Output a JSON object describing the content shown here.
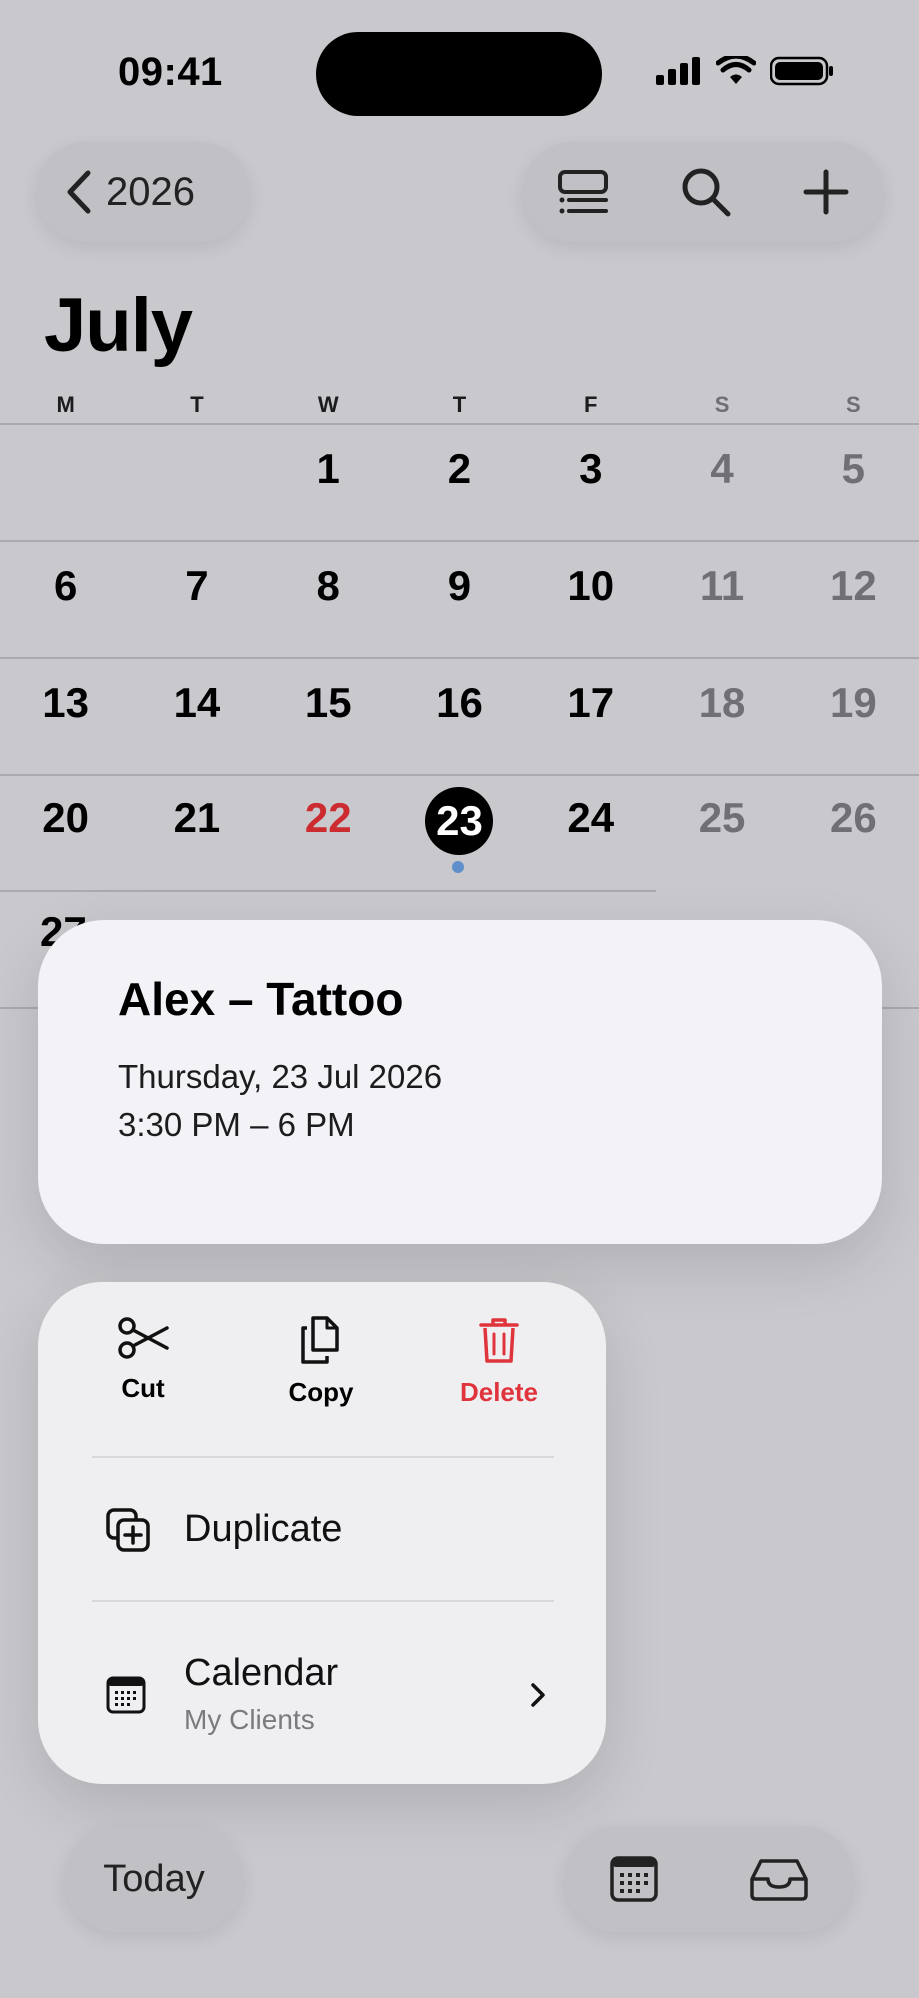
{
  "status_bar": {
    "time": "09:41"
  },
  "nav": {
    "back_label": "2026"
  },
  "calendar": {
    "month": "July",
    "weekdays": [
      "M",
      "T",
      "W",
      "T",
      "F",
      "S",
      "S"
    ],
    "weeks": [
      [
        "",
        "",
        "1",
        "2",
        "3",
        "4",
        "5"
      ],
      [
        "6",
        "7",
        "8",
        "9",
        "10",
        "11",
        "12"
      ],
      [
        "13",
        "14",
        "15",
        "16",
        "17",
        "18",
        "19"
      ],
      [
        "20",
        "21",
        "22",
        "23",
        "24",
        "25",
        "26"
      ]
    ],
    "partial_week_first_day": "27",
    "today": "22",
    "selected": "23"
  },
  "event": {
    "title": "Alex – Tattoo",
    "date": "Thursday, 23 Jul 2026",
    "time": "3:30 PM – 6 PM"
  },
  "menu": {
    "cut": "Cut",
    "copy": "Copy",
    "delete": "Delete",
    "duplicate": "Duplicate",
    "calendar_label": "Calendar",
    "calendar_value": "My Clients"
  },
  "bottom": {
    "today": "Today"
  },
  "colors": {
    "accent_red": "#e0343c",
    "event_dot": "#5f8fcb"
  }
}
